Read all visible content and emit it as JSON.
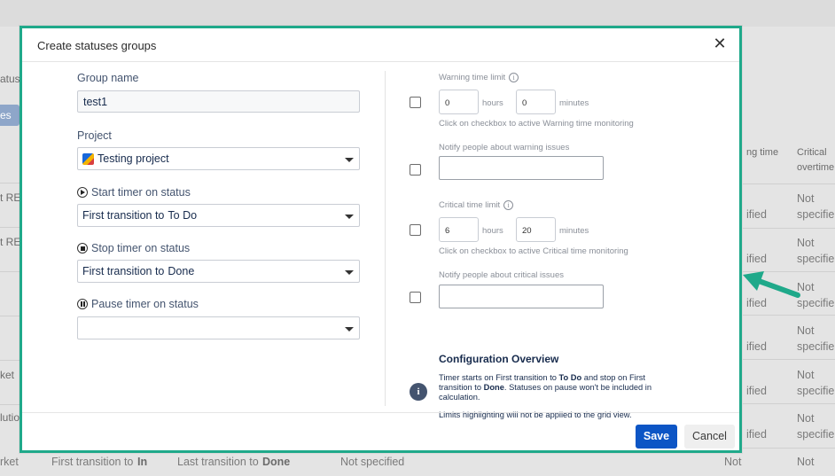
{
  "background": {
    "left_fragments": [
      "atus",
      "es gr",
      "t RE",
      "t RE",
      "ket",
      "lutio",
      "rket"
    ],
    "col_header_1": "ng time",
    "col_header_2a": "Critical",
    "col_header_2b": "overtime",
    "cell_not": "Not",
    "cell_specified_a": "ified",
    "cell_specified_b": "specifie",
    "bottom_row": {
      "first_prefix": "First transition to",
      "first_status": "In",
      "last_prefix": "Last transition to",
      "last_status": "Done",
      "not_specified": "Not specified",
      "not": "Not"
    }
  },
  "modal": {
    "title": "Create statuses groups",
    "close_glyph": "✕",
    "group_name": {
      "label": "Group name",
      "value": "test1"
    },
    "project": {
      "label": "Project",
      "value": "Testing project"
    },
    "start_timer": {
      "label": "Start timer on status",
      "prefix": "First transition to",
      "status": "To Do"
    },
    "stop_timer": {
      "label": "Stop timer on status",
      "prefix": "First transition to",
      "status": "Done"
    },
    "pause_timer": {
      "label": "Pause timer on status",
      "value": ""
    },
    "warning": {
      "label": "Warning time limit",
      "hours": "0",
      "hours_unit": "hours",
      "minutes": "0",
      "minutes_unit": "minutes",
      "hint": "Click on checkbox to active Warning time monitoring",
      "notify_label": "Notify people about warning issues"
    },
    "critical": {
      "label": "Critical time limit",
      "hours": "6",
      "hours_unit": "hours",
      "minutes": "20",
      "minutes_unit": "minutes",
      "hint": "Click on checkbox to active Critical time monitoring",
      "notify_label": "Notify people about critical issues"
    },
    "overview": {
      "title": "Configuration Overview",
      "t1": "Timer starts on First transition to ",
      "b1": "To Do",
      "t2": " and stop on First transition to ",
      "b2": "Done",
      "t3": ". Statuses on pause won't be included in calculation.",
      "note": "Limits highlighting will not be applied to the grid view."
    },
    "save_label": "Save",
    "cancel_label": "Cancel"
  },
  "colors": {
    "highlight_border": "#1fa98a",
    "primary_button": "#0c55c5",
    "arrow": "#1fa98a"
  }
}
